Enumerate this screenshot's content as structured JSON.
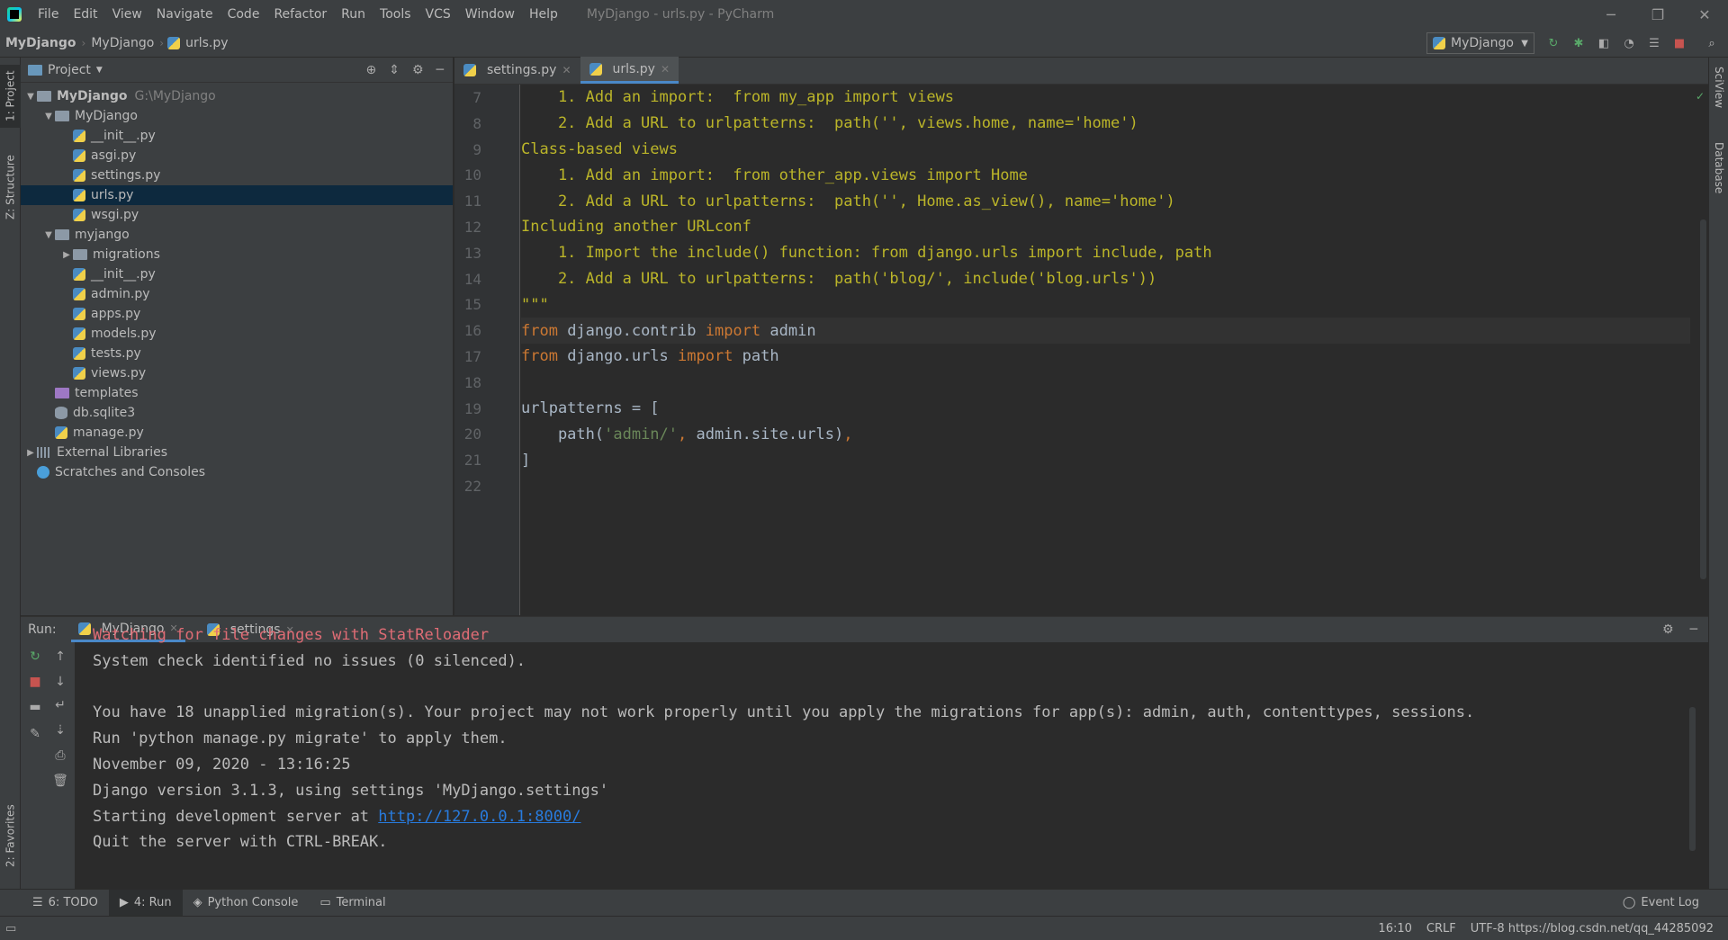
{
  "menubar": {
    "items": [
      "File",
      "Edit",
      "View",
      "Navigate",
      "Code",
      "Refactor",
      "Run",
      "Tools",
      "VCS",
      "Window",
      "Help"
    ],
    "window_title": "MyDjango - urls.py - PyCharm"
  },
  "navbar": {
    "crumbs": [
      "MyDjango",
      "MyDjango",
      "urls.py"
    ],
    "run_config": "MyDjango"
  },
  "left_stripe": {
    "project_tab": "1: Project",
    "structure_tab": "Z: Structure",
    "favorites_tab": "2: Favorites"
  },
  "right_stripe": {
    "sciview_tab": "SciView",
    "database_tab": "Database"
  },
  "project": {
    "title": "Project",
    "tree": [
      {
        "label": "MyDjango",
        "hint": "G:\\MyDjango",
        "depth": 0,
        "type": "folder",
        "expanded": true,
        "bold": true
      },
      {
        "label": "MyDjango",
        "depth": 1,
        "type": "folder",
        "expanded": true
      },
      {
        "label": "__init__.py",
        "depth": 2,
        "type": "py"
      },
      {
        "label": "asgi.py",
        "depth": 2,
        "type": "py"
      },
      {
        "label": "settings.py",
        "depth": 2,
        "type": "py"
      },
      {
        "label": "urls.py",
        "depth": 2,
        "type": "py",
        "selected": true
      },
      {
        "label": "wsgi.py",
        "depth": 2,
        "type": "py"
      },
      {
        "label": "myjango",
        "depth": 1,
        "type": "folder",
        "expanded": true
      },
      {
        "label": "migrations",
        "depth": 2,
        "type": "folder",
        "collapsed": true
      },
      {
        "label": "__init__.py",
        "depth": 2,
        "type": "py"
      },
      {
        "label": "admin.py",
        "depth": 2,
        "type": "py"
      },
      {
        "label": "apps.py",
        "depth": 2,
        "type": "py"
      },
      {
        "label": "models.py",
        "depth": 2,
        "type": "py"
      },
      {
        "label": "tests.py",
        "depth": 2,
        "type": "py"
      },
      {
        "label": "views.py",
        "depth": 2,
        "type": "py"
      },
      {
        "label": "templates",
        "depth": 1,
        "type": "purple"
      },
      {
        "label": "db.sqlite3",
        "depth": 1,
        "type": "db"
      },
      {
        "label": "manage.py",
        "depth": 1,
        "type": "py"
      },
      {
        "label": "External Libraries",
        "depth": 0,
        "type": "lib",
        "collapsed": true
      },
      {
        "label": "Scratches and Consoles",
        "depth": 0,
        "type": "scratch"
      }
    ]
  },
  "editor": {
    "tabs": [
      {
        "label": "settings.py",
        "active": false
      },
      {
        "label": "urls.py",
        "active": true
      }
    ],
    "lines": [
      {
        "n": "7",
        "parts": [
          {
            "c": "doc",
            "t": "    1. Add an import:  from my_app import views"
          }
        ]
      },
      {
        "n": "8",
        "parts": [
          {
            "c": "doc",
            "t": "    2. Add a URL to urlpatterns:  path('', views.home, name='home')"
          }
        ]
      },
      {
        "n": "9",
        "parts": [
          {
            "c": "doc",
            "t": "Class-based views"
          }
        ]
      },
      {
        "n": "10",
        "parts": [
          {
            "c": "doc",
            "t": "    1. Add an import:  from other_app.views import Home"
          }
        ]
      },
      {
        "n": "11",
        "parts": [
          {
            "c": "doc",
            "t": "    2. Add a URL to urlpatterns:  path('', Home.as_view(), name='home')"
          }
        ]
      },
      {
        "n": "12",
        "parts": [
          {
            "c": "doc",
            "t": "Including another URLconf"
          }
        ]
      },
      {
        "n": "13",
        "parts": [
          {
            "c": "doc",
            "t": "    1. Import the include() function: from django.urls import include, path"
          }
        ]
      },
      {
        "n": "14",
        "parts": [
          {
            "c": "doc",
            "t": "    2. Add a URL to urlpatterns:  path('blog/', include('blog.urls'))"
          }
        ]
      },
      {
        "n": "15",
        "parts": [
          {
            "c": "doc",
            "t": "\"\"\""
          }
        ]
      },
      {
        "n": "16",
        "cur": true,
        "parts": [
          {
            "c": "kw",
            "t": "from"
          },
          {
            "c": "plain",
            "t": " django.contrib "
          },
          {
            "c": "kw",
            "t": "import"
          },
          {
            "c": "plain",
            "t": " admin"
          }
        ]
      },
      {
        "n": "17",
        "parts": [
          {
            "c": "kw",
            "t": "from"
          },
          {
            "c": "plain",
            "t": " django.urls "
          },
          {
            "c": "kw",
            "t": "import"
          },
          {
            "c": "plain",
            "t": " path"
          }
        ]
      },
      {
        "n": "18",
        "parts": []
      },
      {
        "n": "19",
        "parts": [
          {
            "c": "plain",
            "t": "urlpatterns = ["
          }
        ]
      },
      {
        "n": "20",
        "parts": [
          {
            "c": "plain",
            "t": "    path("
          },
          {
            "c": "str",
            "t": "'admin/'"
          },
          {
            "c": "kw",
            "t": ", "
          },
          {
            "c": "plain",
            "t": "admin.site.urls)"
          },
          {
            "c": "kw",
            "t": ","
          }
        ]
      },
      {
        "n": "21",
        "parts": [
          {
            "c": "plain",
            "t": "]"
          }
        ]
      },
      {
        "n": "22",
        "parts": []
      }
    ]
  },
  "run": {
    "label": "Run:",
    "tabs": [
      {
        "label": "MyDjango",
        "active": true
      },
      {
        "label": "settings",
        "active": false
      }
    ],
    "console": [
      {
        "c": "red",
        "t": "Watching for file changes with StatReloader"
      },
      {
        "c": "txt",
        "t": "System check identified no issues (0 silenced)."
      },
      {
        "c": "txt",
        "t": ""
      },
      {
        "c": "txt",
        "t": "You have 18 unapplied migration(s). Your project may not work properly until you apply the migrations for app(s): admin, auth, contenttypes, sessions."
      },
      {
        "c": "txt",
        "t": "Run 'python manage.py migrate' to apply them."
      },
      {
        "c": "txt",
        "t": "November 09, 2020 - 13:16:25"
      },
      {
        "c": "txt",
        "t": "Django version 3.1.3, using settings 'MyDjango.settings'"
      },
      {
        "c": "txt",
        "t": "Starting development server at ",
        "link": "http://127.0.0.1:8000/"
      },
      {
        "c": "txt",
        "t": "Quit the server with CTRL-BREAK."
      }
    ]
  },
  "bottombar": {
    "tabs": [
      {
        "label": "6: TODO"
      },
      {
        "label": "4: Run",
        "active": true
      },
      {
        "label": "Python Console"
      },
      {
        "label": "Terminal"
      }
    ],
    "event_log": "Event Log"
  },
  "statusbar": {
    "position": "16:10",
    "line_sep": "CRLF",
    "encoding_overlay": "UTF-8   https://blog.csdn.net/qq_44285092"
  },
  "colors": {
    "accent": "#4a88c7",
    "doc": "#bbb529",
    "keyword": "#cc7832",
    "string": "#6a8759",
    "error": "#e06c75",
    "link": "#287bde"
  }
}
